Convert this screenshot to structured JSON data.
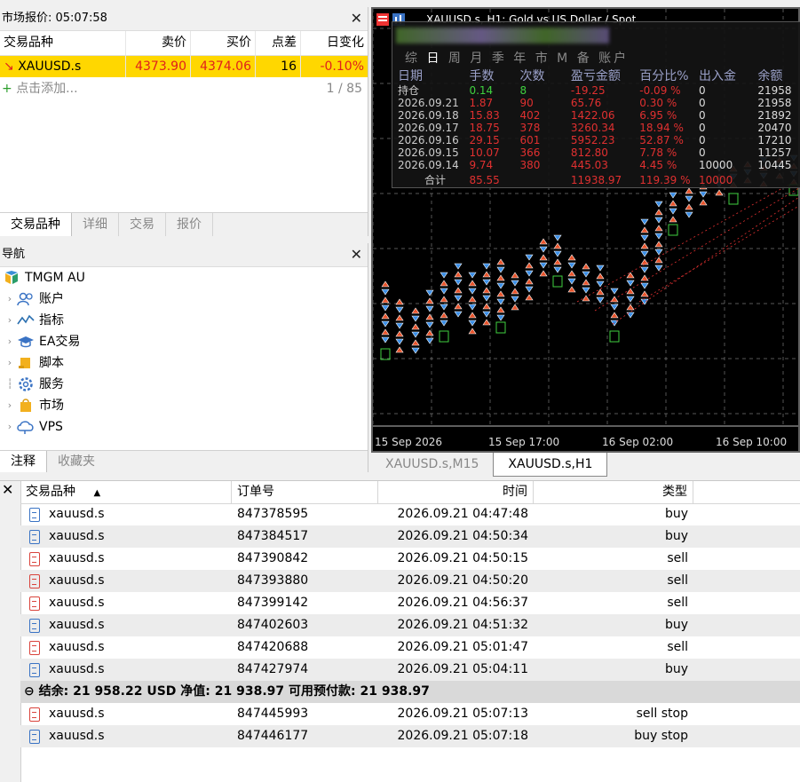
{
  "market_watch": {
    "title": "市场报价: 05:07:58",
    "columns": [
      "交易品种",
      "卖价",
      "买价",
      "点差",
      "日变化"
    ],
    "rows": [
      {
        "symbol": "XAUUSD.s",
        "bid": "4373.90",
        "ask": "4374.06",
        "spread": "16",
        "change": "-0.10%"
      }
    ],
    "add_label": "点击添加...",
    "count": "1 / 85",
    "tabs": [
      "交易品种",
      "详细",
      "交易",
      "报价"
    ]
  },
  "navigator": {
    "title": "导航",
    "root": "TMGM AU",
    "items": [
      "账户",
      "指标",
      "EA交易",
      "脚本",
      "服务",
      "市场",
      "VPS"
    ],
    "tabs": [
      "注释",
      "收藏夹"
    ]
  },
  "chart": {
    "title": "XAUUSD.s, H1:  Gold vs US Dollar / Spot",
    "x_labels": [
      "15 Sep 2026",
      "15 Sep 17:00",
      "16 Sep 02:00",
      "16 Sep 10:00"
    ],
    "tabs": [
      "XAUUSD.s,M15",
      "XAUUSD.s,H1"
    ]
  },
  "stats_popup": {
    "period_tabs": [
      "综",
      "日",
      "周",
      "月",
      "季",
      "年",
      "市",
      "M",
      "备",
      "账户"
    ],
    "headers": [
      "日期",
      "手数",
      "次数",
      "盈亏金额",
      "百分比%",
      "出入金",
      "余额"
    ],
    "rows": [
      [
        "持仓",
        "0.14",
        "8",
        "-19.25",
        "-0.09 %",
        "0",
        "21958"
      ],
      [
        "2026.09.21",
        "1.87",
        "90",
        "65.76",
        "0.30 %",
        "0",
        "21958"
      ],
      [
        "2026.09.18",
        "15.83",
        "402",
        "1422.06",
        "6.95 %",
        "0",
        "21892"
      ],
      [
        "2026.09.17",
        "18.75",
        "378",
        "3260.34",
        "18.94 %",
        "0",
        "20470"
      ],
      [
        "2026.09.16",
        "29.15",
        "601",
        "5952.23",
        "52.87 %",
        "0",
        "17210"
      ],
      [
        "2026.09.15",
        "10.07",
        "366",
        "812.80",
        "7.78 %",
        "0",
        "11257"
      ],
      [
        "2026.09.14",
        "9.74",
        "380",
        "445.03",
        "4.45 %",
        "10000",
        "10445"
      ]
    ],
    "total": [
      "合计",
      "85.55",
      "",
      "11938.97",
      "119.39 %",
      "10000",
      ""
    ]
  },
  "orders": {
    "columns": [
      "交易品种",
      "订单号",
      "时间",
      "类型"
    ],
    "rows": [
      {
        "symbol": "xauusd.s",
        "order": "847378595",
        "time": "2026.09.21 04:47:48",
        "type": "buy"
      },
      {
        "symbol": "xauusd.s",
        "order": "847384517",
        "time": "2026.09.21 04:50:34",
        "type": "buy"
      },
      {
        "symbol": "xauusd.s",
        "order": "847390842",
        "time": "2026.09.21 04:50:15",
        "type": "sell"
      },
      {
        "symbol": "xauusd.s",
        "order": "847393880",
        "time": "2026.09.21 04:50:20",
        "type": "sell"
      },
      {
        "symbol": "xauusd.s",
        "order": "847399142",
        "time": "2026.09.21 04:56:37",
        "type": "sell"
      },
      {
        "symbol": "xauusd.s",
        "order": "847402603",
        "time": "2026.09.21 04:51:32",
        "type": "buy"
      },
      {
        "symbol": "xauusd.s",
        "order": "847420688",
        "time": "2026.09.21 05:01:47",
        "type": "sell"
      },
      {
        "symbol": "xauusd.s",
        "order": "847427974",
        "time": "2026.09.21 05:04:11",
        "type": "buy"
      }
    ],
    "summary": "结余: 21 958.22 USD  净值: 21 938.97  可用预付款: 21 938.97",
    "pending": [
      {
        "symbol": "xauusd.s",
        "order": "847445993",
        "time": "2026.09.21 05:07:13",
        "type": "sell stop"
      },
      {
        "symbol": "xauusd.s",
        "order": "847446177",
        "time": "2026.09.21 05:07:18",
        "type": "buy stop"
      }
    ]
  },
  "colors": {
    "highlight": "#ffd700",
    "sell": "#e0201c",
    "buy": "#3a73c4"
  }
}
